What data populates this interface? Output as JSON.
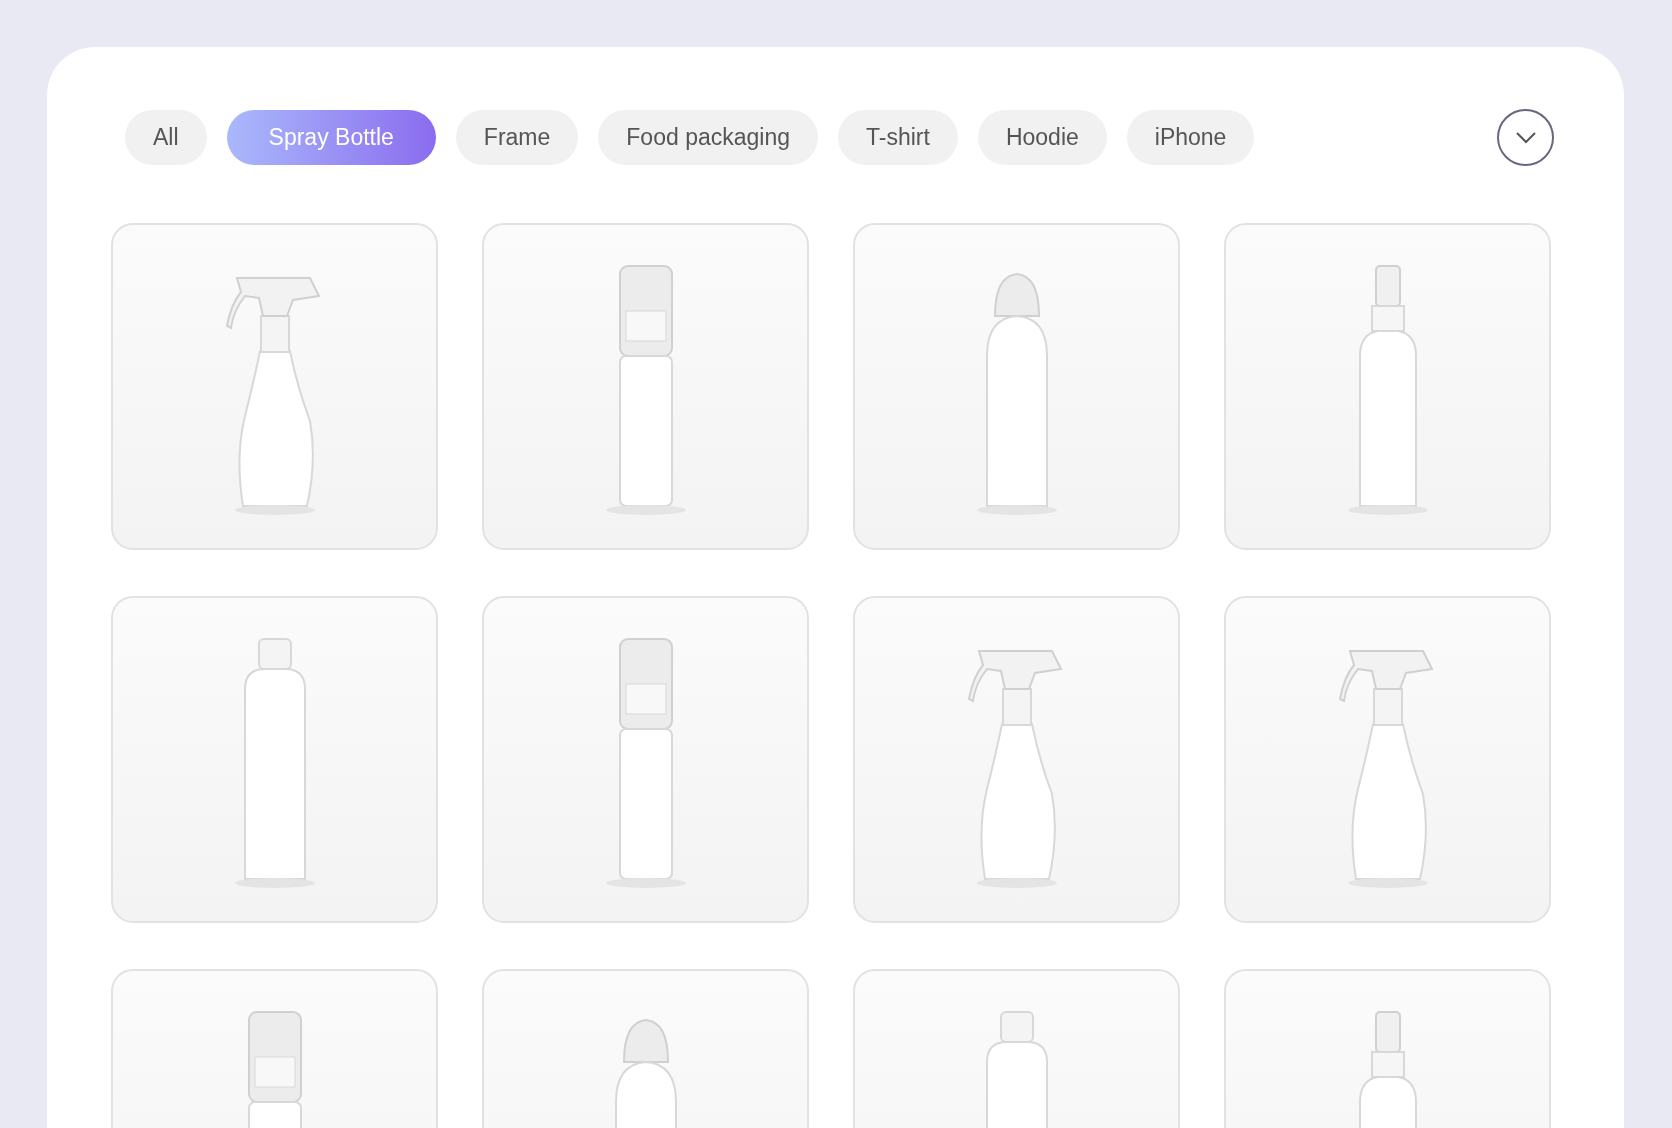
{
  "tabs": [
    {
      "label": "All",
      "selected": false
    },
    {
      "label": "Spray Bottle",
      "selected": true
    },
    {
      "label": "Frame",
      "selected": false
    },
    {
      "label": "Food packaging",
      "selected": false
    },
    {
      "label": "T-shirt",
      "selected": false
    },
    {
      "label": "Hoodie",
      "selected": false
    },
    {
      "label": "iPhone",
      "selected": false
    }
  ],
  "products": [
    {
      "kind": "trigger"
    },
    {
      "kind": "pump"
    },
    {
      "kind": "aerosol"
    },
    {
      "kind": "mist"
    },
    {
      "kind": "bottle"
    },
    {
      "kind": "pump"
    },
    {
      "kind": "trigger"
    },
    {
      "kind": "trigger"
    },
    {
      "kind": "pump"
    },
    {
      "kind": "aerosol"
    },
    {
      "kind": "bottle"
    },
    {
      "kind": "mist"
    }
  ]
}
